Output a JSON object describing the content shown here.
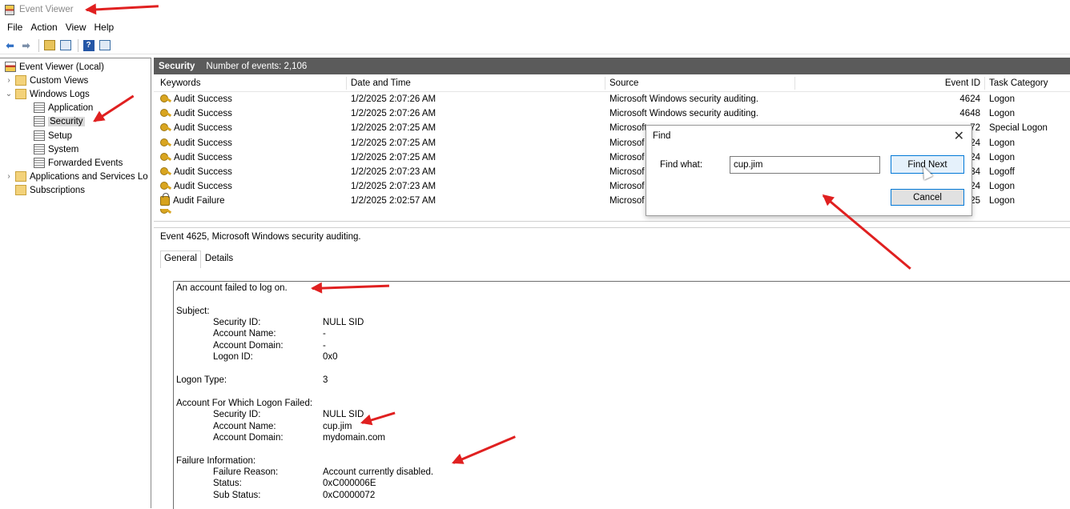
{
  "window": {
    "title": "Event Viewer"
  },
  "menu": [
    "File",
    "Action",
    "View",
    "Help"
  ],
  "tree": {
    "root": "Event Viewer (Local)",
    "custom_views": "Custom Views",
    "windows_logs": "Windows Logs",
    "logs": [
      "Application",
      "Security",
      "Setup",
      "System",
      "Forwarded Events"
    ],
    "app_services": "Applications and Services Lo",
    "subscriptions": "Subscriptions"
  },
  "panel": {
    "title": "Security",
    "count_text": "Number of events: 2,106"
  },
  "grid": {
    "headers": {
      "keywords": "Keywords",
      "date": "Date and Time",
      "source": "Source",
      "event_id": "Event ID",
      "category": "Task Category"
    },
    "rows": [
      {
        "keyword": "Audit Success",
        "date": "1/2/2025 2:07:26 AM",
        "source": "Microsoft Windows security auditing.",
        "event_id": "4624",
        "category": "Logon"
      },
      {
        "keyword": "Audit Success",
        "date": "1/2/2025 2:07:26 AM",
        "source": "Microsoft Windows security auditing.",
        "event_id": "4648",
        "category": "Logon"
      },
      {
        "keyword": "Audit Success",
        "date": "1/2/2025 2:07:25 AM",
        "source": "Microsoft",
        "event_id": "72",
        "category": "Special Logon"
      },
      {
        "keyword": "Audit Success",
        "date": "1/2/2025 2:07:25 AM",
        "source": "Microsof",
        "event_id": "24",
        "category": "Logon"
      },
      {
        "keyword": "Audit Success",
        "date": "1/2/2025 2:07:25 AM",
        "source": "Microsof",
        "event_id": "24",
        "category": "Logon"
      },
      {
        "keyword": "Audit Success",
        "date": "1/2/2025 2:07:23 AM",
        "source": "Microsof",
        "event_id": "34",
        "category": "Logoff"
      },
      {
        "keyword": "Audit Success",
        "date": "1/2/2025 2:07:23 AM",
        "source": "Microsof",
        "event_id": "24",
        "category": "Logon"
      },
      {
        "keyword": "Audit Failure",
        "date": "1/2/2025 2:02:57 AM",
        "source": "Microsof",
        "event_id": "25",
        "category": "Logon"
      }
    ]
  },
  "find": {
    "title": "Find",
    "label": "Find what:",
    "value": "cup.jim",
    "find_next": "Find Next",
    "cancel": "Cancel"
  },
  "detail": {
    "title": "Event 4625, Microsoft Windows security auditing.",
    "tabs": [
      "General",
      "Details"
    ],
    "summary": "An account failed to log on.",
    "subject_label": "Subject:",
    "subject": [
      {
        "k": "Security ID:",
        "v": "NULL SID"
      },
      {
        "k": "Account Name:",
        "v": "-"
      },
      {
        "k": "Account Domain:",
        "v": "-"
      },
      {
        "k": "Logon ID:",
        "v": "0x0"
      }
    ],
    "logon_type_label": "Logon Type:",
    "logon_type": "3",
    "failed_label": "Account For Which Logon Failed:",
    "failed": [
      {
        "k": "Security ID:",
        "v": "NULL SID"
      },
      {
        "k": "Account Name:",
        "v": "cup.jim"
      },
      {
        "k": "Account Domain:",
        "v": "mydomain.com"
      }
    ],
    "failure_label": "Failure Information:",
    "failure": [
      {
        "k": "Failure Reason:",
        "v": "Account currently disabled."
      },
      {
        "k": "Status:",
        "v": "0xC000006E"
      },
      {
        "k": "Sub Status:",
        "v": "0xC0000072"
      }
    ]
  },
  "colors": {
    "annotation": "#e02020",
    "header_bg": "#5b5b5b",
    "accent": "#0078d7"
  }
}
